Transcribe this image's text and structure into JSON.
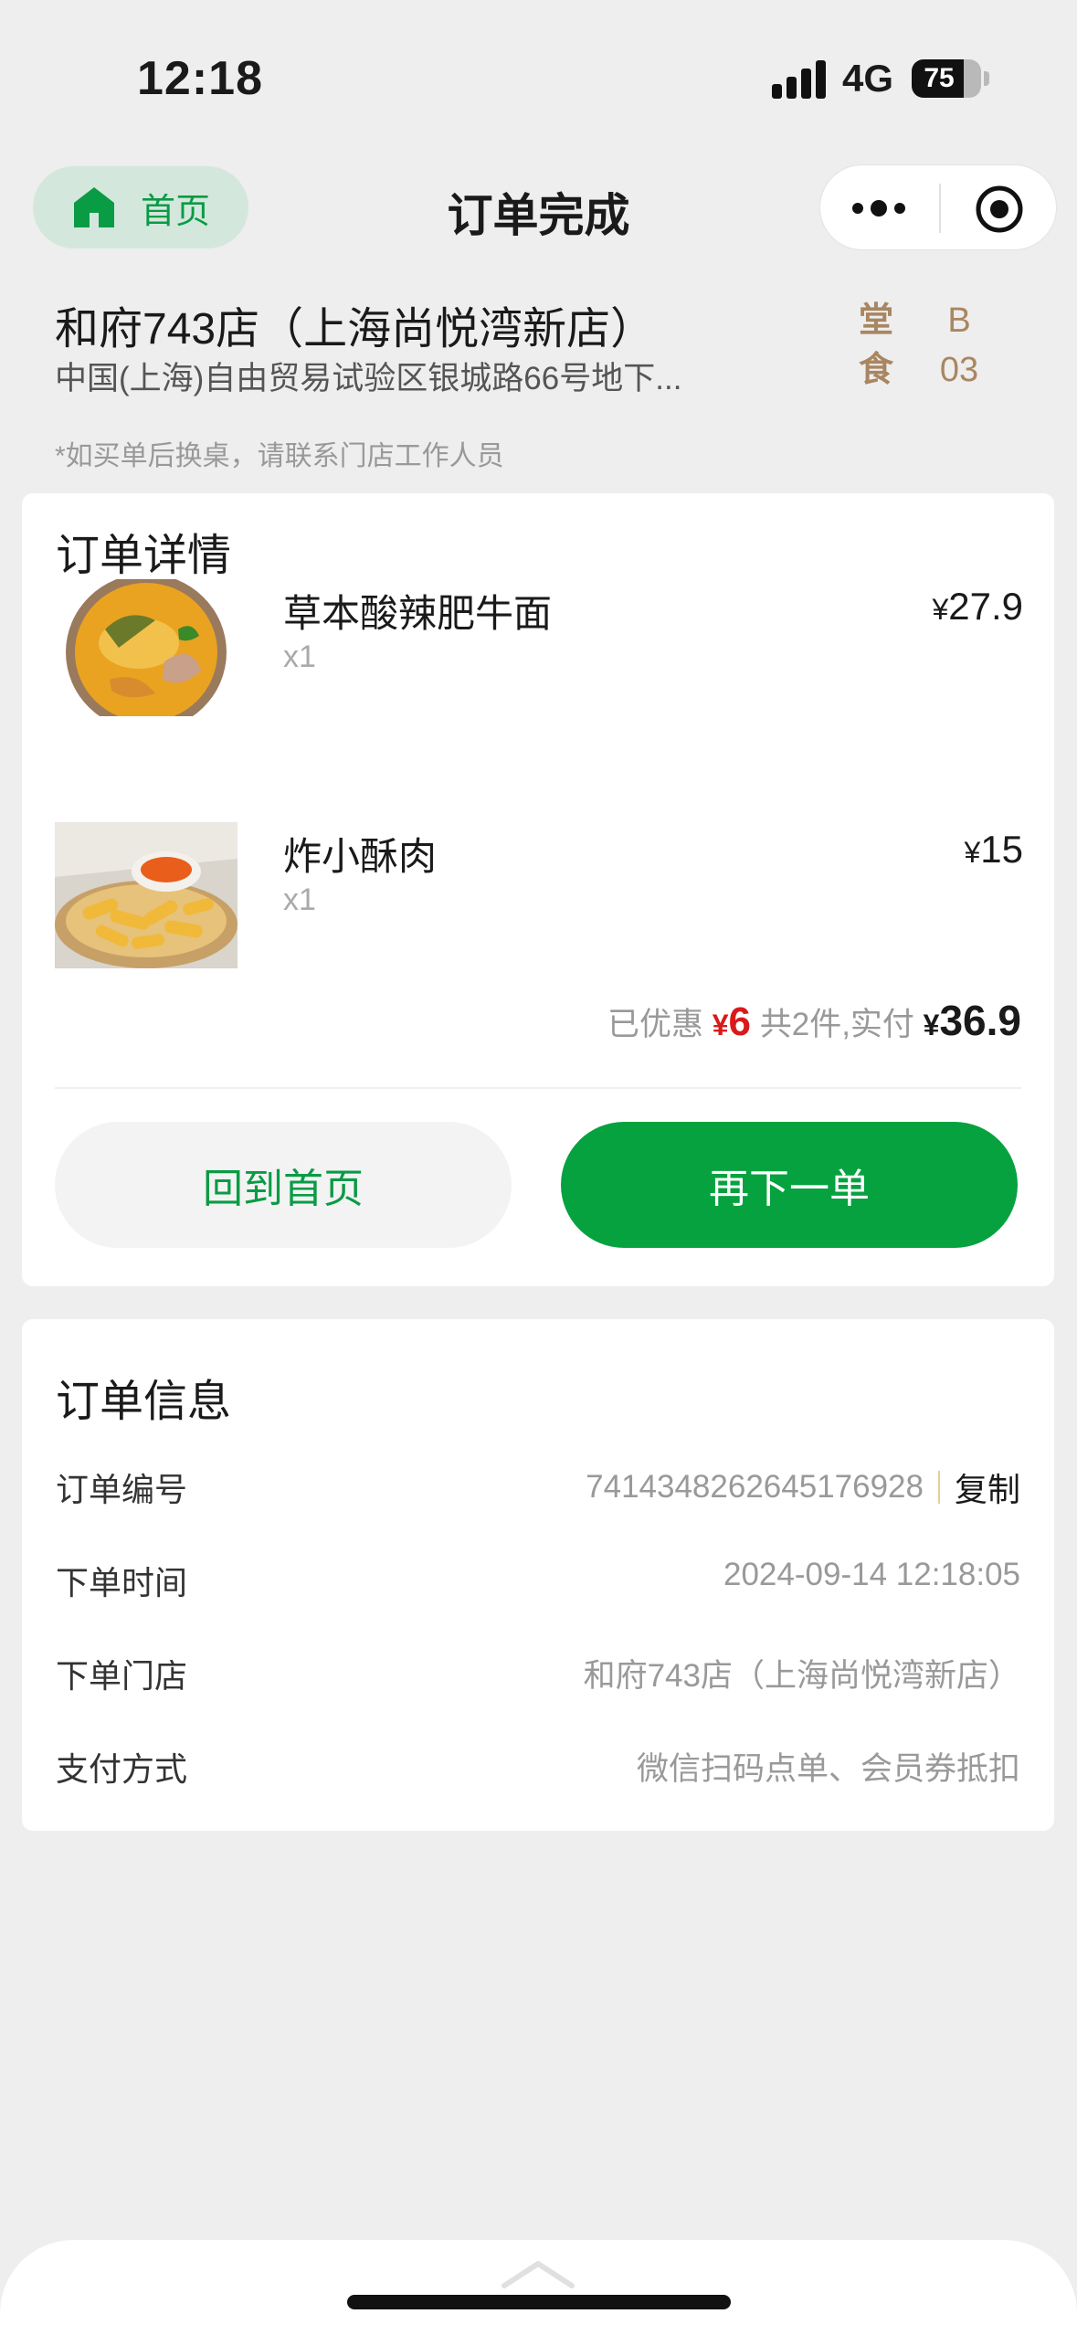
{
  "status_bar": {
    "time": "12:18",
    "network": "4G",
    "battery": "75",
    "battery_level": 0.75
  },
  "nav": {
    "home_label": "首页",
    "title": "订单完成"
  },
  "store": {
    "name": "和府743店（上海尚悦湾新店）",
    "address": "中国(上海)自由贸易试验区银城路66号地下...",
    "dine_type": [
      "堂",
      "食"
    ],
    "table_no": [
      "B",
      "03"
    ],
    "note": "*如买单后换桌，请联系门店工作人员"
  },
  "order": {
    "title": "订单详情",
    "items": [
      {
        "name": "草本酸辣肥牛面",
        "qty": "x1",
        "currency": "¥",
        "price": "27.9"
      },
      {
        "name": "炸小酥肉",
        "qty": "x1",
        "currency": "¥",
        "price": "15"
      }
    ],
    "summary": {
      "discount_label": "已优惠",
      "discount_currency": "¥",
      "discount_value": "6",
      "count_label": "共2件,实付",
      "total_currency": "¥",
      "total_value": "36.9"
    },
    "buttons": {
      "home": "回到首页",
      "reorder": "再下一单"
    }
  },
  "info": {
    "title": "订单信息",
    "rows": [
      {
        "label": "订单编号",
        "value": "7414348262645176928",
        "action": "复制"
      },
      {
        "label": "下单时间",
        "value": "2024-09-14 12:18:05"
      },
      {
        "label": "下单门店",
        "value": "和府743店（上海尚悦湾新店）"
      },
      {
        "label": "支付方式",
        "value": "微信扫码点单、会员券抵扣"
      }
    ]
  },
  "colors": {
    "brand_green": "#06a23f",
    "accent_red": "#d91a1a",
    "gold": "#a98661",
    "background": "#eeeeee"
  },
  "icons": {
    "home": "house-icon",
    "more": "more-dots-icon",
    "close": "target-close-icon",
    "chevron": "chevron-up-icon"
  }
}
